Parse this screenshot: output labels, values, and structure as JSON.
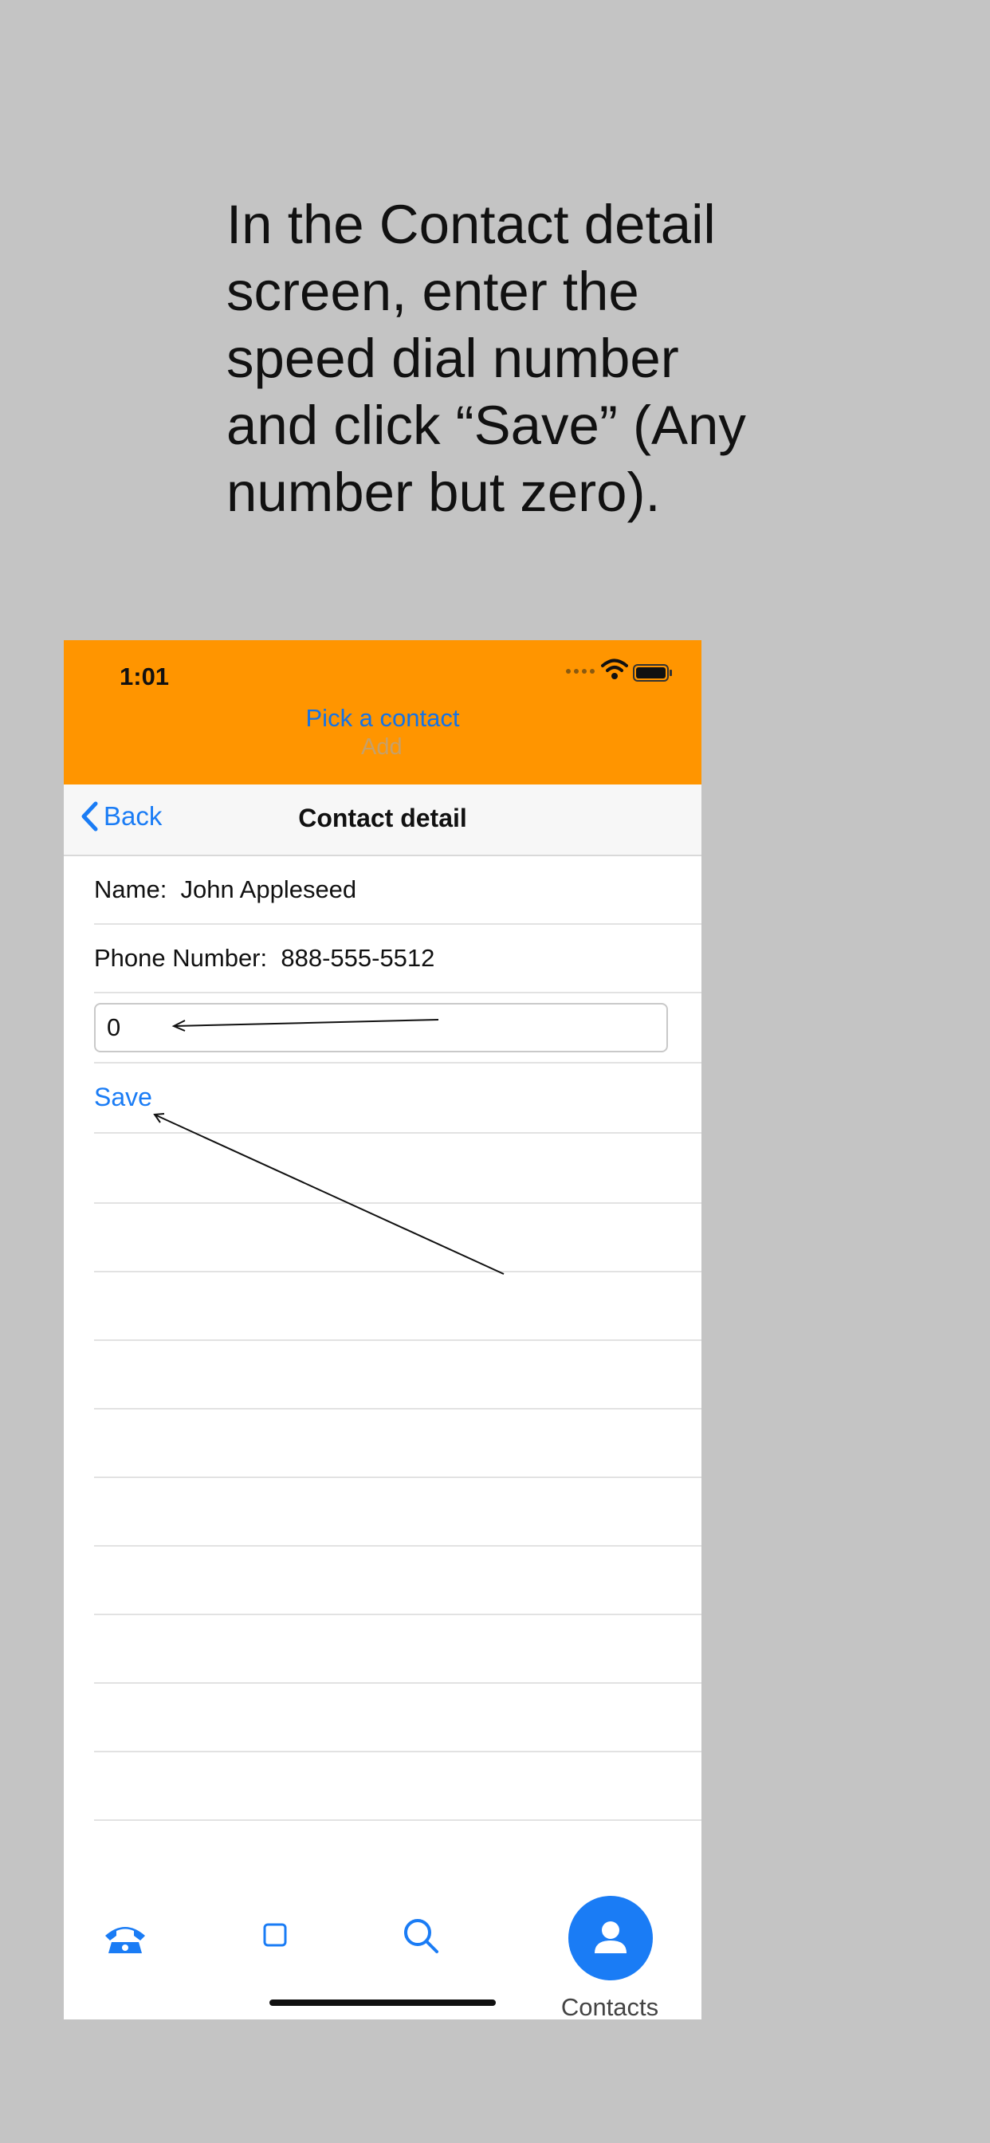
{
  "instruction": "In the Contact detail\nscreen, enter the\nspeed dial number\nand click “Save” (Any\nnumber but zero).",
  "status_bar": {
    "time": "1:01"
  },
  "top": {
    "pick_label": "Pick a contact",
    "add_label": "Add"
  },
  "navbar": {
    "back_label": "Back",
    "title": "Contact detail"
  },
  "detail": {
    "name_row": "Name:  John Appleseed",
    "phone_row": "Phone Number:  888-555-5512",
    "speed_dial_value": "0",
    "save_label": "Save"
  },
  "tabbar": {
    "contacts_label": "Contacts"
  },
  "colors": {
    "accent": "#1a7cf5",
    "header": "#ff9500",
    "background": "#c4c4c4"
  }
}
